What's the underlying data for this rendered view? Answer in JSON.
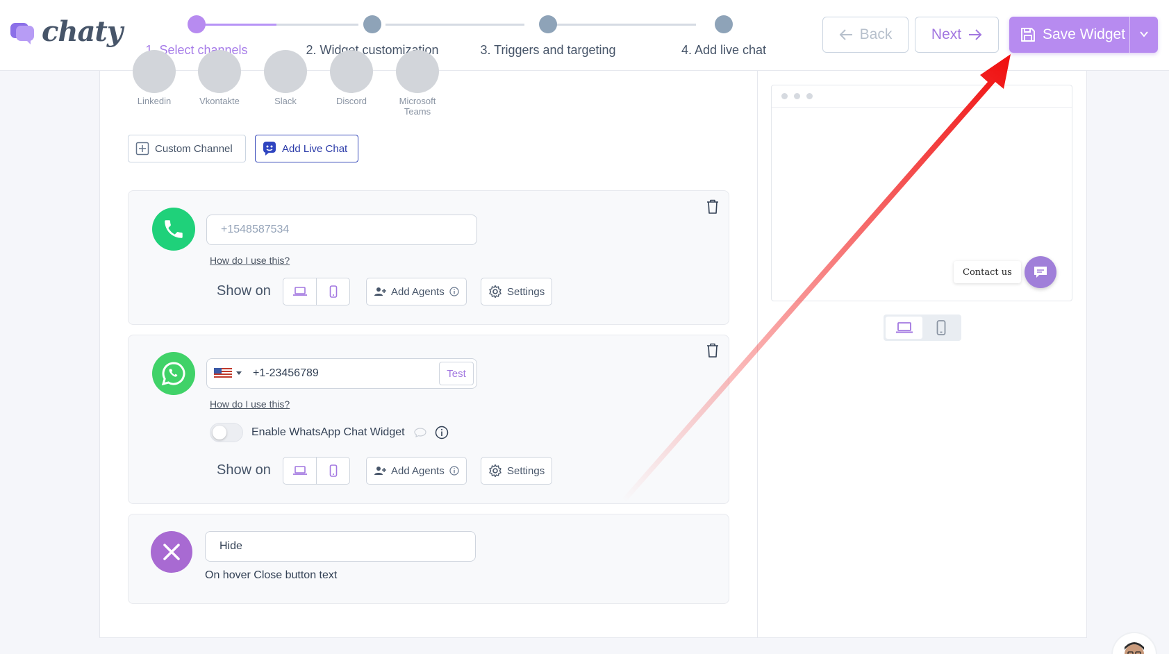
{
  "app": {
    "logo_text": "chaty"
  },
  "stepper": {
    "steps": [
      {
        "label": "1. Select channels",
        "active": true
      },
      {
        "label": "2. Widget customization",
        "active": false
      },
      {
        "label": "3. Triggers and targeting",
        "active": false
      },
      {
        "label": "4. Add live chat",
        "active": false
      }
    ]
  },
  "header": {
    "back_label": "Back",
    "next_label": "Next",
    "save_label": "Save Widget"
  },
  "channels": [
    {
      "name": "Linkedin"
    },
    {
      "name": "Vkontakte"
    },
    {
      "name": "Slack"
    },
    {
      "name": "Discord"
    },
    {
      "name": "Microsoft Teams"
    }
  ],
  "actions": {
    "custom_channel_label": "Custom Channel",
    "add_live_chat_label": "Add Live Chat"
  },
  "phone_card": {
    "placeholder": "+1548587534",
    "howto": "How do I use this?",
    "show_on": "Show on",
    "add_agents": "Add Agents",
    "settings": "Settings"
  },
  "whatsapp_card": {
    "value": "+1-23456789",
    "test_label": "Test",
    "howto": "How do I use this?",
    "enable_widget_label": "Enable WhatsApp Chat Widget",
    "show_on": "Show on",
    "add_agents": "Add Agents",
    "settings": "Settings"
  },
  "close_card": {
    "value": "Hide",
    "caption": "On hover Close button text"
  },
  "preview": {
    "contact_label": "Contact us"
  },
  "colors": {
    "accent": "#b78bf0",
    "phone_green": "#1fd17a",
    "whatsapp_green": "#40d268",
    "close_purple": "#a86ad2",
    "annotation_red": "#f01010"
  }
}
